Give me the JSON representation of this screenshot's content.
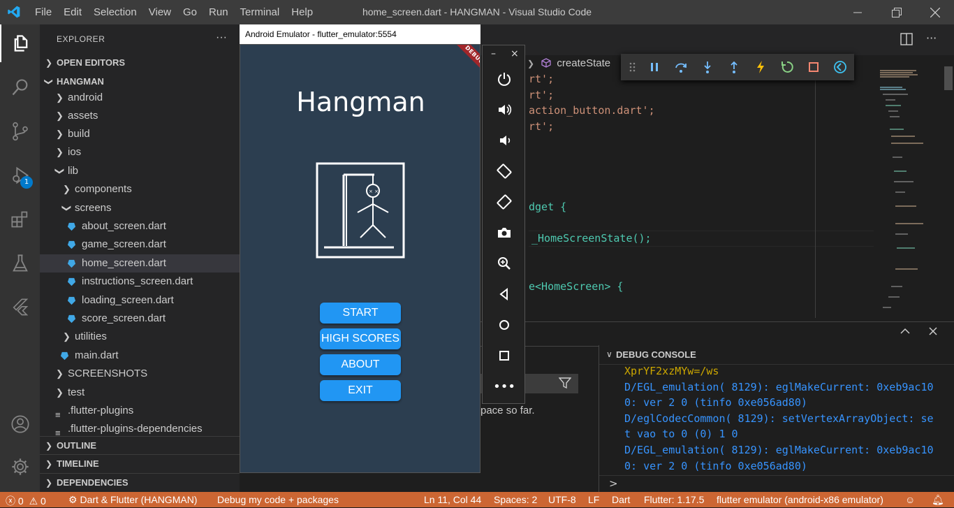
{
  "window": {
    "title": "home_screen.dart - HANGMAN - Visual Studio Code",
    "menu": [
      "File",
      "Edit",
      "Selection",
      "View",
      "Go",
      "Run",
      "Terminal",
      "Help"
    ]
  },
  "activity": {
    "debug_badge": "1"
  },
  "sidebar": {
    "header": "EXPLORER",
    "open_editors": "OPEN EDITORS",
    "project": "HANGMAN",
    "items": [
      {
        "label": "android"
      },
      {
        "label": "assets"
      },
      {
        "label": "build"
      },
      {
        "label": "ios"
      },
      {
        "label": "lib"
      },
      {
        "label": "components"
      },
      {
        "label": "screens"
      },
      {
        "label": "about_screen.dart"
      },
      {
        "label": "game_screen.dart"
      },
      {
        "label": "home_screen.dart"
      },
      {
        "label": "instructions_screen.dart"
      },
      {
        "label": "loading_screen.dart"
      },
      {
        "label": "score_screen.dart"
      },
      {
        "label": "utilities"
      },
      {
        "label": "main.dart"
      },
      {
        "label": "SCREENSHOTS"
      },
      {
        "label": "test"
      },
      {
        "label": ".flutter-plugins"
      },
      {
        "label": ".flutter-plugins-dependencies"
      }
    ],
    "outline": "OUTLINE",
    "timeline": "TIMELINE",
    "dependencies": "DEPENDENCIES"
  },
  "editor": {
    "breadcrumb": "createState",
    "lines": [
      "rt';",
      "rt';",
      "action_button.dart';",
      "rt';",
      "dget {",
      "_HomeScreenState();",
      "e<HomeScreen> {"
    ]
  },
  "panel": {
    "debug_console_label": "DEBUG CONSOLE",
    "partial_text": "pace so far.",
    "console_lines": [
      "XprYF2xzMYw=/ws",
      "D/EGL_emulation( 8129): eglMakeCurrent: 0xeb9ac10",
      "0: ver 2 0 (tinfo 0xe056ad80)",
      "D/eglCodecCommon( 8129): setVertexArrayObject: se",
      "t vao to 0 (0) 1 0",
      "D/EGL_emulation( 8129): eglMakeCurrent: 0xeb9ac10",
      "0: ver 2 0 (tinfo 0xe056ad80)"
    ],
    "prompt": ">"
  },
  "status": {
    "errors": "0",
    "warnings": "0",
    "launch": "Dart & Flutter (HANGMAN)",
    "debug_mode": "Debug my code + packages",
    "position": "Ln 11, Col 44",
    "spaces": "Spaces: 2",
    "encoding": "UTF-8",
    "eol": "LF",
    "language": "Dart",
    "flutter": "Flutter: 1.17.5",
    "device": "flutter emulator (android-x86 emulator)"
  },
  "emulator": {
    "title": "Android Emulator - flutter_emulator:5554",
    "debug_banner": "DEBUG",
    "app_title": "Hangman",
    "buttons": [
      "START",
      "HIGH SCORES",
      "ABOUT",
      "EXIT"
    ]
  }
}
